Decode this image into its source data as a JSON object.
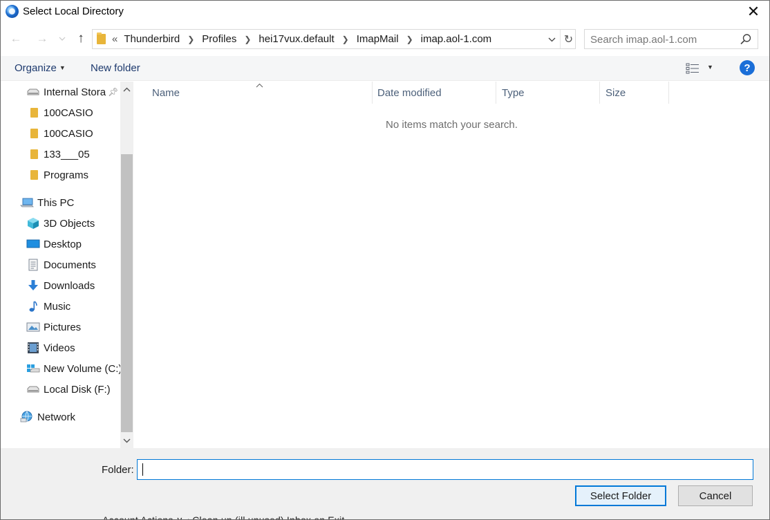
{
  "window": {
    "title": "Select Local Directory",
    "close_glyph": "✕"
  },
  "nav_buttons": {
    "back": "←",
    "forward": "→",
    "recent": "⌄",
    "up": "↑"
  },
  "address": {
    "overflow": "«",
    "crumbs": [
      "Thunderbird",
      "Profiles",
      "hei17vux.default",
      "ImapMail",
      "imap.aol-1.com"
    ],
    "dropdown_glyph": "⌄",
    "refresh_glyph": "↻"
  },
  "search": {
    "placeholder": "Search imap.aol-1.com",
    "value": ""
  },
  "toolbar": {
    "organize": "Organize",
    "new_folder": "New folder",
    "help": "?"
  },
  "nav_pane": {
    "items": [
      {
        "label": "Internal Stora",
        "icon": "drive-icon",
        "pinned": true
      },
      {
        "label": "100CASIO",
        "icon": "folder-icon"
      },
      {
        "label": "100CASIO",
        "icon": "folder-icon"
      },
      {
        "label": "133___05",
        "icon": "folder-icon"
      },
      {
        "label": "Programs",
        "icon": "folder-icon"
      },
      {
        "label": "This PC",
        "icon": "this-pc-icon"
      },
      {
        "label": "3D Objects",
        "icon": "3d-objects-icon"
      },
      {
        "label": "Desktop",
        "icon": "desktop-icon"
      },
      {
        "label": "Documents",
        "icon": "documents-icon"
      },
      {
        "label": "Downloads",
        "icon": "downloads-icon"
      },
      {
        "label": "Music",
        "icon": "music-icon"
      },
      {
        "label": "Pictures",
        "icon": "pictures-icon"
      },
      {
        "label": "Videos",
        "icon": "videos-icon"
      },
      {
        "label": "New Volume (C:)",
        "icon": "windows-drive-icon"
      },
      {
        "label": "Local Disk (F:)",
        "icon": "drive-icon"
      },
      {
        "label": "Network",
        "icon": "network-icon"
      }
    ]
  },
  "file_list": {
    "columns": [
      "Name",
      "Date modified",
      "Type",
      "Size"
    ],
    "empty_message": "No items match your search."
  },
  "footer": {
    "folder_label": "Folder:",
    "folder_value": "",
    "select_button": "Select Folder",
    "cancel_button": "Cancel"
  },
  "background_bleed": "Account Actions       ∨              ‹ Clean up (ill unused) Inbox on Exit"
}
